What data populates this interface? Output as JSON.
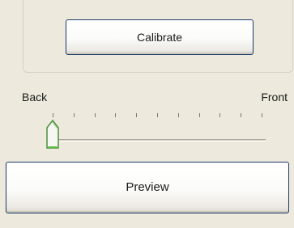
{
  "calibrate_button": {
    "label": "Calibrate"
  },
  "slider": {
    "min_label": "Back",
    "max_label": "Front",
    "value": 0,
    "min": 0,
    "max": 10,
    "tick_count": 11
  },
  "preview_button": {
    "label": "Preview"
  },
  "colors": {
    "background": "#ede9dc",
    "button_border": "#1c3a6b",
    "thumb_accent": "#5bbf3f"
  }
}
